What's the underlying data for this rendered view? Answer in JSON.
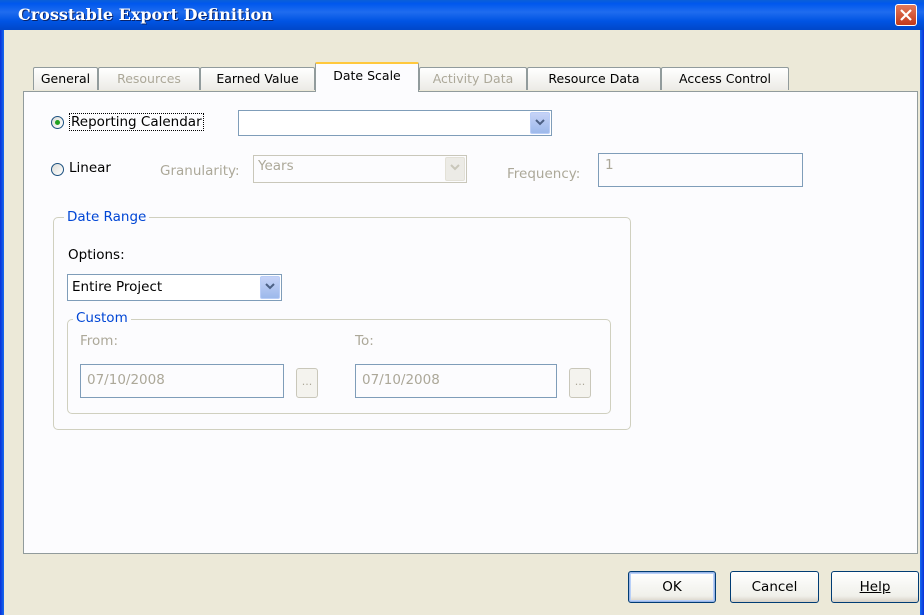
{
  "window": {
    "title": "Crosstable Export Definition"
  },
  "tabs": [
    {
      "label": "General",
      "enabled": true
    },
    {
      "label": "Resources",
      "enabled": false
    },
    {
      "label": "Earned Value",
      "enabled": true
    },
    {
      "label": "Date Scale",
      "enabled": true,
      "active": true
    },
    {
      "label": "Activity Data",
      "enabled": false
    },
    {
      "label": "Resource  Data",
      "enabled": true
    },
    {
      "label": "Access Control",
      "enabled": true
    }
  ],
  "date_scale": {
    "reporting_calendar": {
      "label": "Reporting Calendar",
      "selected": true,
      "value": ""
    },
    "linear": {
      "label": "Linear",
      "selected": false
    },
    "granularity": {
      "label": "Granularity:",
      "value": "Years"
    },
    "frequency": {
      "label": "Frequency:",
      "value": "1"
    }
  },
  "date_range": {
    "legend": "Date Range",
    "options_label": "Options:",
    "options_value": "Entire Project",
    "custom": {
      "legend": "Custom",
      "from_label": "From:",
      "from_value": "07/10/2008",
      "to_label": "To:",
      "to_value": "07/10/2008",
      "browse_label": "..."
    }
  },
  "buttons": {
    "ok": "OK",
    "cancel": "Cancel",
    "help": "Help"
  },
  "colors": {
    "titlebar": "#0054e3",
    "group_label": "#0046d5",
    "active_tab_highlight": "#ffc83c",
    "disabled_text": "#aca899"
  }
}
